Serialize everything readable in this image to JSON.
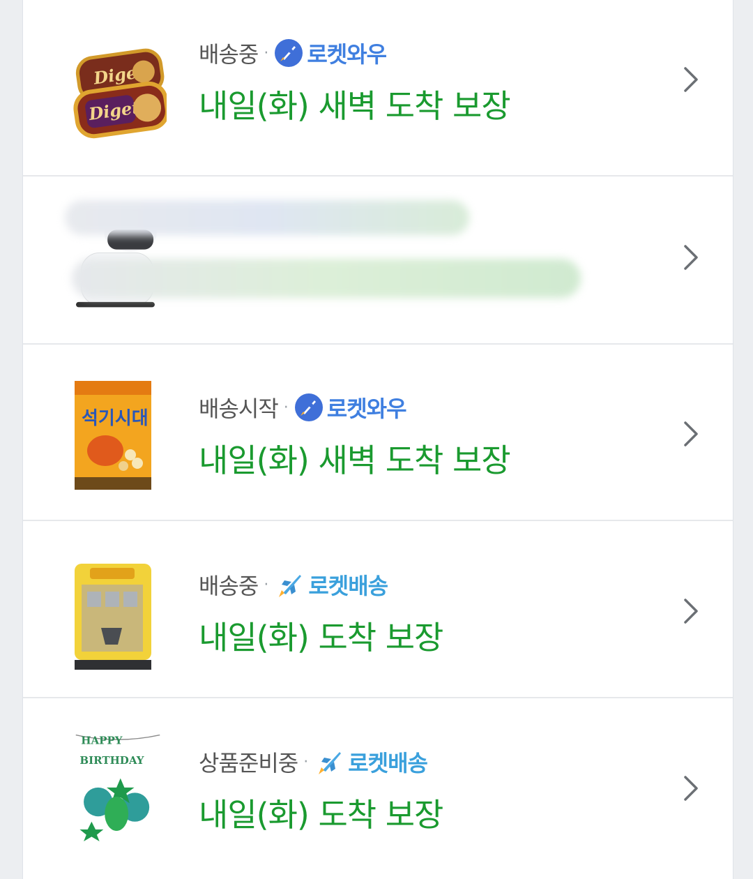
{
  "orders": [
    {
      "status": "배송중",
      "separator": "·",
      "badge": "로켓와우",
      "badge_type": "wow",
      "eta": "내일(화) 새벽 도착 보장",
      "product_icon": "digestive-biscuit-tin"
    },
    {
      "status": "",
      "separator": "",
      "badge": "",
      "badge_type": "",
      "eta": "",
      "product_icon": "home-security-camera",
      "redacted": true
    },
    {
      "status": "배송시작",
      "separator": "·",
      "badge": "로켓와우",
      "badge_type": "wow",
      "eta": "내일(화) 새벽 도착 보장",
      "product_icon": "dinosaur-snack-bag"
    },
    {
      "status": "배송중",
      "separator": "·",
      "badge": "로켓배송",
      "badge_type": "rocket",
      "eta": "내일(화) 도착 보장",
      "product_icon": "toy-blister-pack"
    },
    {
      "status": "상품준비중",
      "separator": "·",
      "badge": "로켓배송",
      "badge_type": "rocket",
      "eta": "내일(화) 도착 보장",
      "product_icon": "birthday-balloon-set"
    }
  ],
  "colors": {
    "eta": "#1a9a2f",
    "wow_badge": "#3f7fe0",
    "rocket_badge": "#3aa0dc",
    "status": "#555555"
  }
}
